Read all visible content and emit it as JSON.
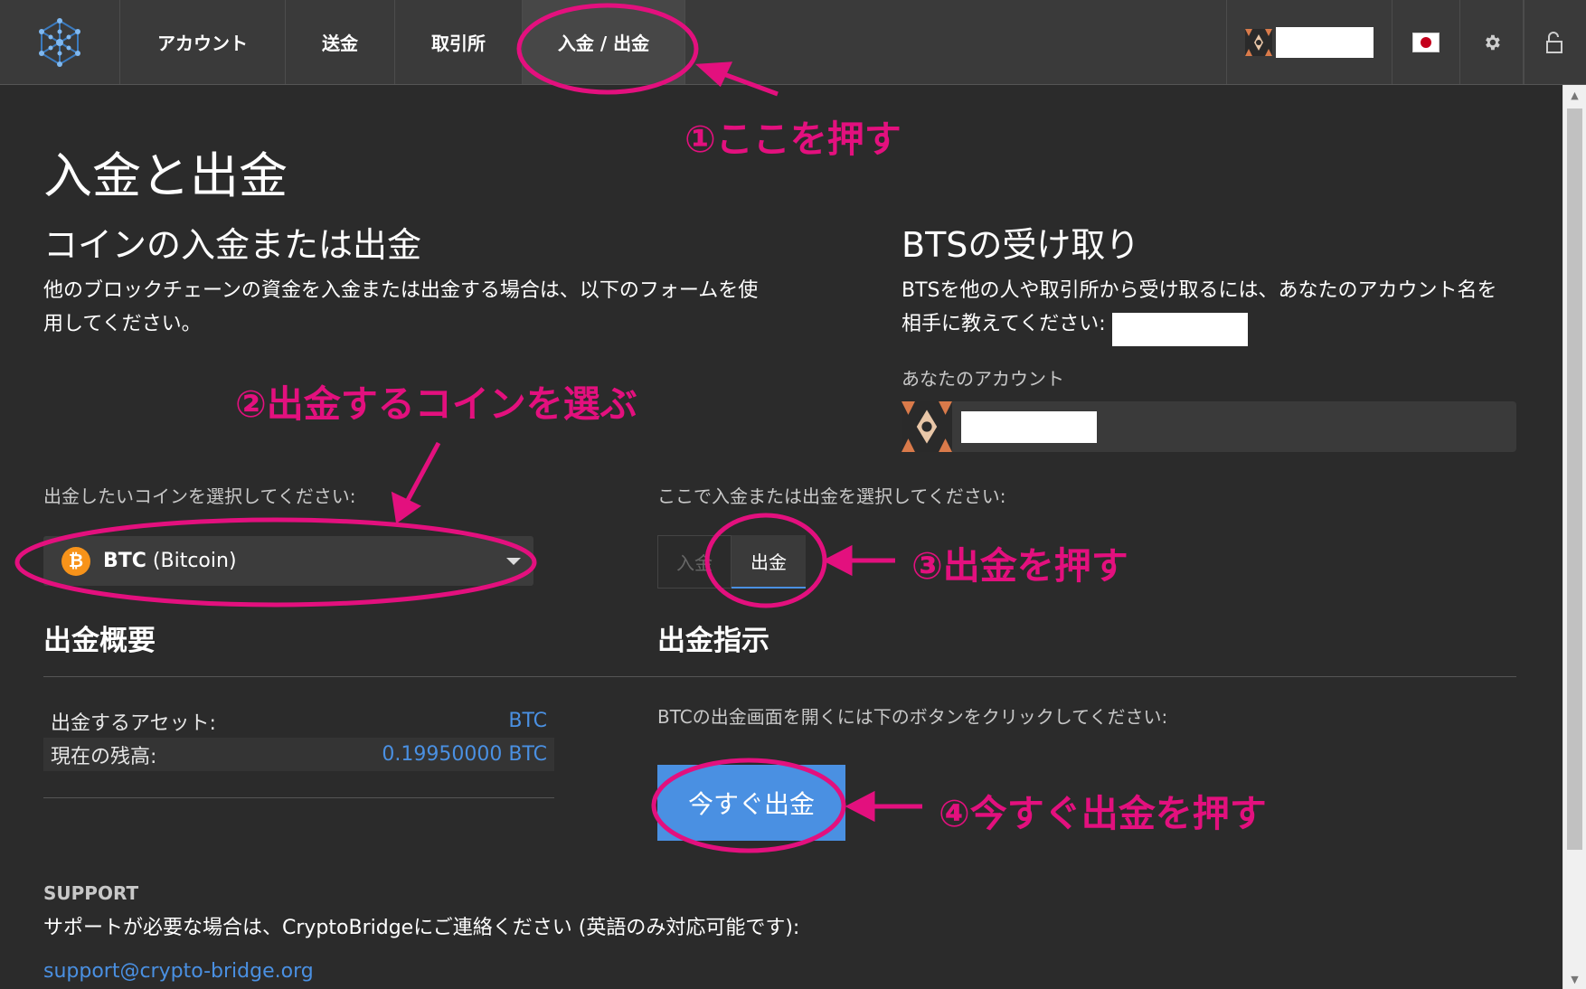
{
  "nav": {
    "items": [
      "アカウント",
      "送金",
      "取引所",
      "入金 / 出金"
    ]
  },
  "page": {
    "title": "入金と出金",
    "left_heading": "コインの入金または出金",
    "left_desc_1": "他のブロックチェーンの資金を入金または出金する場合は、以下のフォームを使",
    "left_desc_2": "用してください。",
    "right_heading": "BTSの受け取り",
    "right_desc_1": "BTSを他の人や取引所から受け取るには、あなたのアカウント名を",
    "right_desc_2": "相手に教えてください:",
    "your_account_label": "あなたのアカウント"
  },
  "coin_select": {
    "label": "出金したいコインを選択してください:",
    "icon_glyph": "₿",
    "ticker": "BTC",
    "name": "(Bitcoin)"
  },
  "mode_select": {
    "label": "ここで入金または出金を選択してください:",
    "deposit": "入金",
    "withdraw": "出金"
  },
  "summary": {
    "heading": "出金概要",
    "rows": [
      {
        "label": "出金するアセット:",
        "value": "BTC"
      },
      {
        "label": "現在の残高:",
        "value": "0.19950000 BTC"
      }
    ]
  },
  "instructions": {
    "heading": "出金指示",
    "text": "BTCの出金画面を開くには下のボタンをクリックしてください:",
    "button": "今すぐ出金"
  },
  "support": {
    "heading": "SUPPORT",
    "text": "サポートが必要な場合は、CryptoBridgeにご連絡ください (英語のみ対応可能です):",
    "email": "support@crypto-bridge.org"
  },
  "annotations": {
    "step1": "①ここを押す",
    "step2": "②出金するコインを選ぶ",
    "step3": "③出金を押す",
    "step4": "④今すぐ出金を押す"
  },
  "colors": {
    "annotation": "#e3107e",
    "accent": "#4a90e2",
    "background": "#2b2b2b"
  }
}
